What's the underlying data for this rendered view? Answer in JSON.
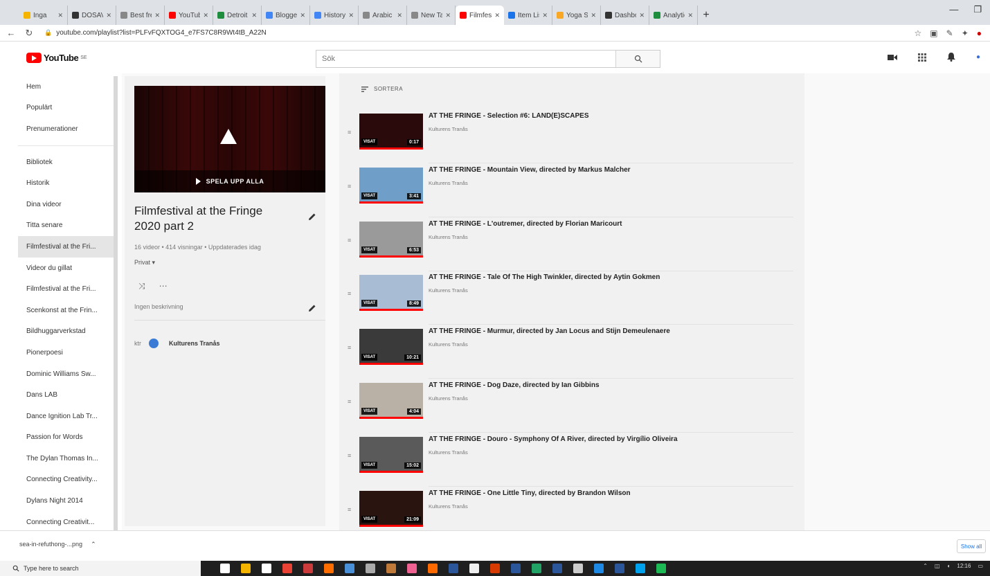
{
  "browser": {
    "tabs": [
      {
        "label": "Inga",
        "color": "#f4b400"
      },
      {
        "label": "DOSAVI",
        "color": "#333333"
      },
      {
        "label": "Best fre",
        "color": "#888888"
      },
      {
        "label": "YouTube",
        "color": "#ff0000"
      },
      {
        "label": "Detroit",
        "color": "#1e8e3e"
      },
      {
        "label": "Blogger",
        "color": "#4285f4"
      },
      {
        "label": "History",
        "color": "#4285f4"
      },
      {
        "label": "Arabic",
        "color": "#888888"
      },
      {
        "label": "New Tab",
        "color": "#888888"
      },
      {
        "label": "Filmfest",
        "color": "#ff0000",
        "active": true
      },
      {
        "label": "Item List",
        "color": "#1a73e8"
      },
      {
        "label": "Yoga Sai",
        "color": "#f9a825"
      },
      {
        "label": "Dashboa",
        "color": "#333333"
      },
      {
        "label": "Analytics",
        "color": "#1e8e3e"
      }
    ],
    "new_tab": "+",
    "url": "youtube.com/playlist?list=PLFvFQXTOG4_e7FS7C8R9Wt4tB_A22N"
  },
  "masthead": {
    "logo_text": "YouTube",
    "logo_region": "SE",
    "search_placeholder": "Sök"
  },
  "sidebar": {
    "group1": [
      "Hem",
      "Populärt",
      "Prenumerationer"
    ],
    "group2": [
      "Bibliotek",
      "Historik",
      "Dina videor",
      "Titta senare",
      "Filmfestival at the Fri...",
      "Videor du gillat",
      "Filmfestival at the Fri...",
      "Scenkonst at the Frin...",
      "Bildhuggarverkstad",
      "Pionerpoesi",
      "Dominic Williams Sw...",
      "Dans LAB",
      "Dance Ignition Lab Tr...",
      "Passion for Words",
      "The Dylan Thomas In...",
      "Connecting Creativity...",
      "Dylans Night 2014",
      "Connecting Creativit..."
    ],
    "active_index": 4
  },
  "playlist": {
    "play_all": "SPELA UPP ALLA",
    "title": "Filmfestival at the Fringe 2020 part 2",
    "stats": "16 videor • 414 visningar • Uppdaterades idag",
    "privacy": "Privat ▾",
    "description": "Ingen beskrivning",
    "owner": "Kulturens Tranås"
  },
  "list": {
    "sort_label": "SORTERA",
    "watched_label": "VISAT",
    "videos": [
      {
        "title": "AT THE FRINGE - Selection #6: LAND(E)SCAPES",
        "channel": "Kulturens Tranås",
        "duration": "0:17",
        "thumb": "#2a0a0a"
      },
      {
        "title": "AT THE FRINGE - Mountain View, directed by Markus Malcher",
        "channel": "Kulturens Tranås",
        "duration": "3:41",
        "thumb": "#6f9fc9"
      },
      {
        "title": "AT THE FRINGE - L'outremer, directed by Florian Maricourt",
        "channel": "Kulturens Tranås",
        "duration": "6:53",
        "thumb": "#9a9a9a"
      },
      {
        "title": "AT THE FRINGE - Tale Of The High Twinkler, directed by Aytin Gokmen",
        "channel": "Kulturens Tranås",
        "duration": "8:49",
        "thumb": "#a8bcd4"
      },
      {
        "title": "AT THE FRINGE - Murmur, directed by Jan Locus and Stijn Demeulenaere",
        "channel": "Kulturens Tranås",
        "duration": "10:21",
        "thumb": "#3a3a3a"
      },
      {
        "title": "AT THE FRINGE - Dog Daze, directed by Ian Gibbins",
        "channel": "Kulturens Tranås",
        "duration": "4:04",
        "thumb": "#b9b0a6"
      },
      {
        "title": "AT THE FRINGE - Douro - Symphony Of A River, directed by Virgílio Oliveira",
        "channel": "Kulturens Tranås",
        "duration": "15:02",
        "thumb": "#5a5a5a"
      },
      {
        "title": "AT THE FRINGE - One Little Tiny, directed by Brandon Wilson",
        "channel": "Kulturens Tranås",
        "duration": "21:09",
        "thumb": "#2a1410"
      }
    ]
  },
  "downloads": {
    "file": "sea-in-refuthong-...png",
    "show_all": "Show all"
  },
  "taskbar": {
    "search_placeholder": "Type here to search",
    "icon_colors": [
      "#ffffff",
      "#f4b400",
      "#ffffff",
      "#ea4335",
      "#cc3b3b",
      "#ff6d00",
      "#4a90d9",
      "#aaaaaa",
      "#bf7a3a",
      "#f06292",
      "#ff6a00",
      "#2b579a",
      "#eeeeee",
      "#d83b01",
      "#2b579a",
      "#21a366",
      "#2b579a",
      "#cccccc",
      "#1e88e5",
      "#2b579a",
      "#00a2ed",
      "#1db954"
    ],
    "time": "12:16"
  }
}
